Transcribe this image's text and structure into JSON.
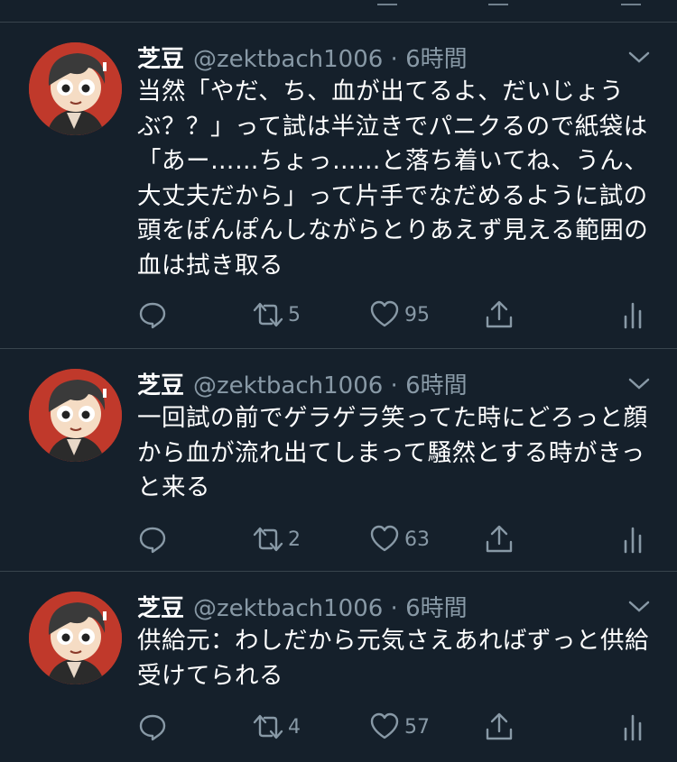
{
  "colors": {
    "background": "#15202b",
    "divider": "#38444d",
    "muted": "#8899a6",
    "text": "#ffffff",
    "avatar_bg": "#c0392b"
  },
  "tweets": [
    {
      "name": "芝豆",
      "handle": "@zektbach1006 · 6時間",
      "text": "当然「やだ、ち、血が出てるよ、だいじょうぶ？？」って試は半泣きでパニクるので紙袋は「あー……ちょっ……と落ち着いてね、うん、大丈夫だから」って片手でなだめるように試の頭をぽんぽんしながらとりあえず見える範囲の血は拭き取る",
      "retweets": "5",
      "likes": "95"
    },
    {
      "name": "芝豆",
      "handle": "@zektbach1006 · 6時間",
      "text": "一回試の前でゲラゲラ笑ってた時にどろっと顔から血が流れ出てしまって騒然とする時がきっと来る",
      "retweets": "2",
      "likes": "63"
    },
    {
      "name": "芝豆",
      "handle": "@zektbach1006 · 6時間",
      "text": "供給元：わしだから元気さえあればずっと供給受けてられる",
      "retweets": "4",
      "likes": "57"
    }
  ]
}
